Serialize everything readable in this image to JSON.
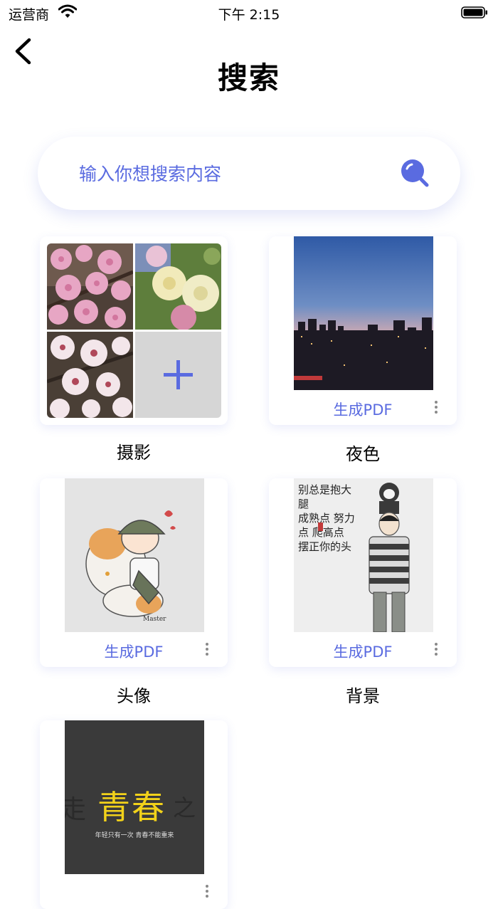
{
  "status_bar": {
    "carrier": "运营商",
    "time": "下午 2:15"
  },
  "header": {
    "title": "搜索"
  },
  "search": {
    "placeholder": "输入你想搜索内容"
  },
  "albums": [
    {
      "name": "摄影"
    },
    {
      "name": "夜色",
      "action": "生成PDF"
    },
    {
      "name": "头像",
      "action": "生成PDF"
    },
    {
      "name": "背景",
      "action": "生成PDF"
    },
    {
      "name": "",
      "action": ""
    }
  ],
  "photo_texts": {
    "background_lines": [
      "别总是抱大腿",
      "成熟点 努力点 爬高点",
      "摆正你的头"
    ],
    "youth_title": "青春",
    "youth_side_left": "走",
    "youth_side_right": "之",
    "youth_caption": "年轻只有一次 青春不能重来"
  },
  "colors": {
    "accent": "#5a6be0",
    "background": "#ffffff",
    "add_tile": "#d6d6d6"
  },
  "icons": [
    "wifi-icon",
    "battery-icon",
    "back-icon",
    "search-icon",
    "plus-icon",
    "more-icon"
  ]
}
